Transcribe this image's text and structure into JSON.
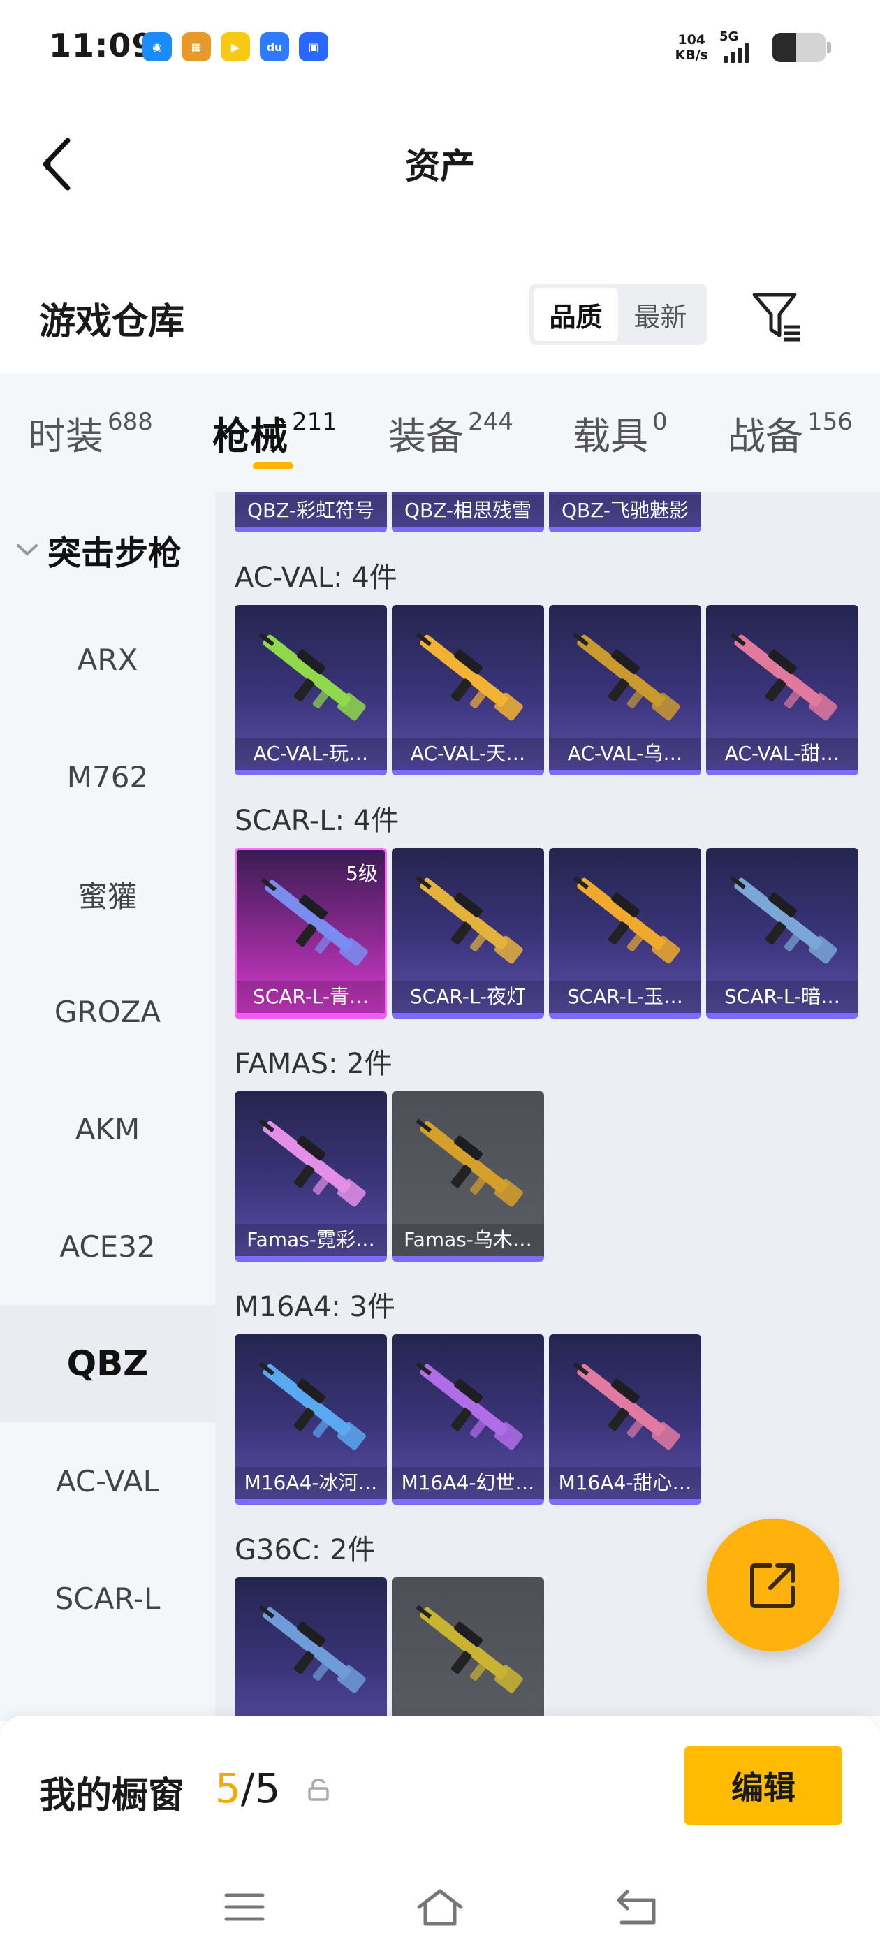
{
  "status_bar": {
    "time": "11:09",
    "net_speed_value": "104",
    "net_speed_unit": "KB/s",
    "signal_label": "5G",
    "battery_level": 0.45,
    "app_icons": [
      {
        "name": "browser-app-icon",
        "color": "#1b8cff",
        "glyph": "◉"
      },
      {
        "name": "game-app-icon",
        "color": "#e79a2a",
        "glyph": "▦"
      },
      {
        "name": "video-app-icon",
        "color": "#f7c816",
        "glyph": "▶"
      },
      {
        "name": "du-app-icon",
        "color": "#2f7bff",
        "glyph": "du"
      },
      {
        "name": "chat-app-icon",
        "color": "#2a67ff",
        "glyph": "▣"
      }
    ]
  },
  "header": {
    "title": "资产"
  },
  "warehouse": {
    "title": "游戏仓库",
    "sort_options": [
      {
        "label": "品质",
        "active": true
      },
      {
        "label": "最新",
        "active": false
      }
    ]
  },
  "categories": [
    {
      "label": "时装",
      "count": "688",
      "active": false
    },
    {
      "label": "枪械",
      "count": "211",
      "active": true
    },
    {
      "label": "装备",
      "count": "244",
      "active": false
    },
    {
      "label": "载具",
      "count": "0",
      "active": false
    },
    {
      "label": "战备",
      "count": "156",
      "active": false
    }
  ],
  "sidebar": {
    "group_label": "突击步枪",
    "items": [
      {
        "label": "ARX",
        "active": false
      },
      {
        "label": "M762",
        "active": false
      },
      {
        "label": "蜜獾",
        "active": false
      },
      {
        "label": "GROZA",
        "active": false
      },
      {
        "label": "AKM",
        "active": false
      },
      {
        "label": "ACE32",
        "active": false
      },
      {
        "label": "QBZ",
        "active": true
      },
      {
        "label": "AC-VAL",
        "active": false
      },
      {
        "label": "SCAR-L",
        "active": false
      }
    ]
  },
  "groups": [
    {
      "title": "",
      "items": [
        {
          "name": "QBZ-彩虹符号",
          "style": "purple",
          "accent": "#6ad6e8"
        },
        {
          "name": "QBZ-相思残雪",
          "style": "purple",
          "accent": "#d8d8e8"
        },
        {
          "name": "QBZ-飞驰魅影",
          "style": "purple",
          "accent": "#e9e9f5"
        }
      ]
    },
    {
      "title": "AC-VAL: 4件",
      "items": [
        {
          "name": "AC-VAL-玩…",
          "style": "purple",
          "accent": "#8fd94a"
        },
        {
          "name": "AC-VAL-天…",
          "style": "purple",
          "accent": "#f2b233"
        },
        {
          "name": "AC-VAL-乌…",
          "style": "purple",
          "accent": "#c99a2e"
        },
        {
          "name": "AC-VAL-甜…",
          "style": "purple",
          "accent": "#e0799c"
        }
      ]
    },
    {
      "title": "SCAR-L: 4件",
      "items": [
        {
          "name": "SCAR-L-青…",
          "style": "pink",
          "level": "5级",
          "accent": "#7b8cf0"
        },
        {
          "name": "SCAR-L-夜灯",
          "style": "purple",
          "accent": "#e3b23c"
        },
        {
          "name": "SCAR-L-玉…",
          "style": "purple",
          "accent": "#f0a92a"
        },
        {
          "name": "SCAR-L-暗…",
          "style": "purple",
          "accent": "#7aa7d6"
        }
      ]
    },
    {
      "title": "FAMAS: 2件",
      "items": [
        {
          "name": "Famas-霓彩…",
          "style": "purple",
          "accent": "#e38fe8"
        },
        {
          "name": "Famas-乌木…",
          "style": "grey",
          "accent": "#d4a02a"
        }
      ]
    },
    {
      "title": "M16A4: 3件",
      "items": [
        {
          "name": "M16A4-冰河…",
          "style": "purple",
          "accent": "#5aa8f0"
        },
        {
          "name": "M16A4-幻世…",
          "style": "purple",
          "accent": "#b06de8"
        },
        {
          "name": "M16A4-甜心…",
          "style": "purple",
          "accent": "#e07aa0"
        }
      ]
    },
    {
      "title": "G36C: 2件",
      "items": [
        {
          "name": "",
          "style": "purple",
          "accent": "#6f9bd8"
        },
        {
          "name": "",
          "style": "grey",
          "accent": "#c9b431"
        }
      ]
    }
  ],
  "showcase": {
    "title": "我的橱窗",
    "used": "5",
    "separator": "/",
    "total": "5",
    "edit_label": "编辑"
  },
  "colors": {
    "accent": "#ffb400",
    "card_border": "#7d6bff"
  }
}
